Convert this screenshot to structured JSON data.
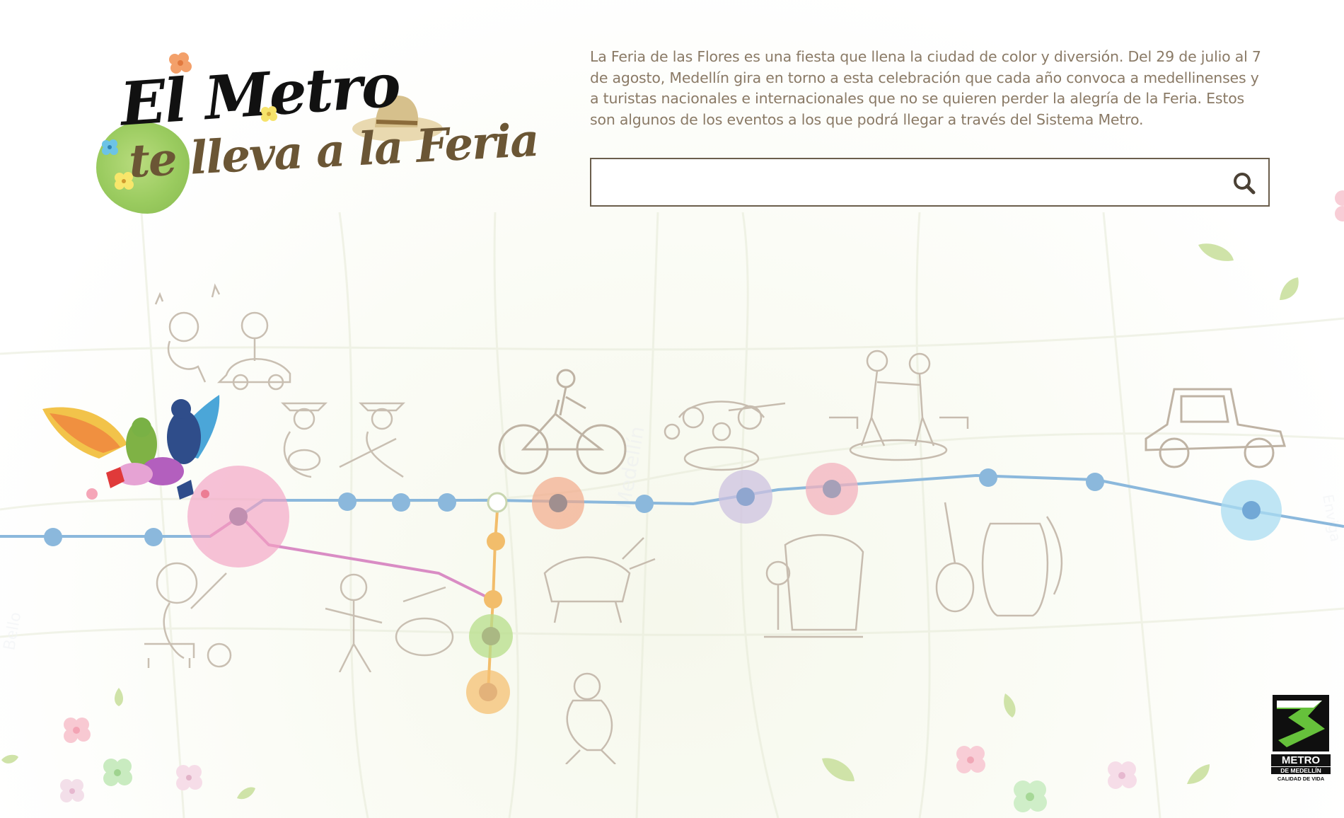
{
  "logo": {
    "line1": "El Metro",
    "line2": "te lleva a la Feria"
  },
  "intro": {
    "text": "La Feria de las Flores es una fiesta que llena la ciudad de color y diversión. Del 29 de julio al 7 de agosto, Medellín gira en torno a esta celebración que cada año convoca a medellinenses y a turistas nacionales e internacionales que no se quieren perder la alegría de la Feria. Estos son algunos de los eventos a los que podrá llegar a través del Sistema Metro."
  },
  "search": {
    "value": "",
    "placeholder": "",
    "icon": "search-icon"
  },
  "colors": {
    "text": "#8a7a66",
    "border": "#6b5e4c",
    "line_a": "#8bb8dc",
    "line_b": "#d98cc4",
    "line_c": "#f2bd6b"
  },
  "map_labels": {
    "bello": "Bello",
    "medellin": "Medellín",
    "envigado": "Enviga"
  },
  "brand": {
    "name": "METRO",
    "sub": "DE MEDELLÍN",
    "tag": "CALIDAD DE VIDA"
  }
}
